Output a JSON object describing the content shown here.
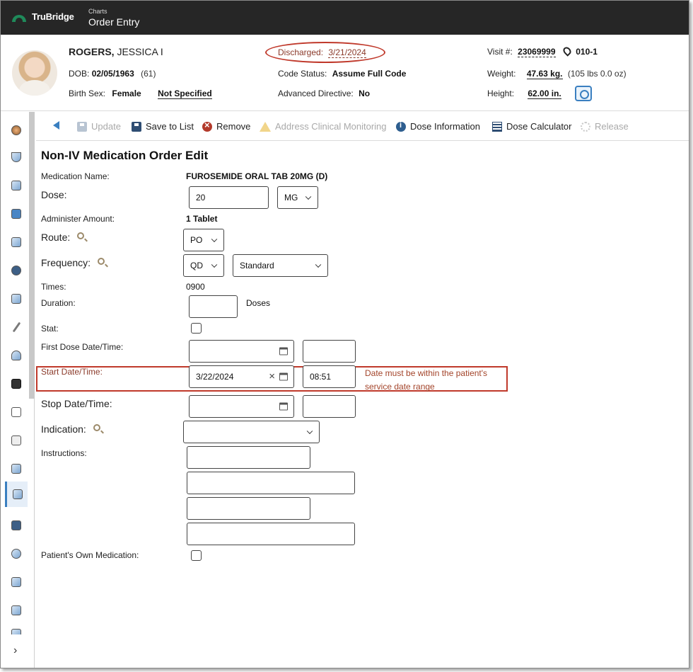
{
  "app": {
    "brand": "TruBridge",
    "breadcrumb_section": "Charts",
    "breadcrumb_page": "Order Entry"
  },
  "patient": {
    "last_name": "ROGERS,",
    "first_name": " JESSICA I",
    "dob_label": "DOB:",
    "dob": "02/05/1963",
    "age": "(61)",
    "birth_sex_label": "Birth Sex:",
    "birth_sex": "Female",
    "gender_identity": "Not Specified",
    "discharged_label": "Discharged:",
    "discharged_date": "3/21/2024",
    "code_status_label": "Code Status:",
    "code_status": "Assume Full Code",
    "advanced_directive_label": "Advanced Directive:",
    "advanced_directive": "No",
    "visit_label": "Visit #:",
    "visit_number": "23069999",
    "location": "010-1",
    "weight_label": "Weight:",
    "weight": "47.63 kg.",
    "weight_lbs": "(105 lbs 0.0 oz)",
    "height_label": "Height:",
    "height": "62.00 in."
  },
  "toolbar": {
    "update": "Update",
    "save_to_list": "Save to List",
    "remove": "Remove",
    "address_monitoring": "Address Clinical Monitoring",
    "dose_information": "Dose Information",
    "dose_calculator": "Dose Calculator",
    "release": "Release"
  },
  "form": {
    "title": "Non-IV Medication Order Edit",
    "medication_name_label": "Medication Name:",
    "medication_name": "FUROSEMIDE ORAL TAB 20MG (D)",
    "dose_label": "Dose:",
    "dose_value": "20",
    "dose_unit": "MG",
    "administer_amount_label": "Administer Amount:",
    "administer_amount": "1 Tablet",
    "route_label": "Route:",
    "route_value": "PO",
    "frequency_label": "Frequency:",
    "frequency_value": "QD",
    "frequency_type": "Standard",
    "times_label": "Times:",
    "times_value": "0900",
    "duration_label": "Duration:",
    "duration_value": "",
    "duration_unit": "Doses",
    "stat_label": "Stat:",
    "first_dose_label": "First Dose Date/Time:",
    "first_dose_date": "",
    "first_dose_time": "",
    "start_label": "Start Date/Time:",
    "start_date": "3/22/2024",
    "start_time": "08:51",
    "start_error": "Date must be within the patient's service date range",
    "stop_label": "Stop Date/Time:",
    "stop_date": "",
    "stop_time": "",
    "indication_label": "Indication:",
    "indication_value": "",
    "instructions_label": "Instructions:",
    "instructions": [
      "",
      "",
      "",
      ""
    ],
    "own_med_label": "Patient's Own Medication:"
  },
  "colors": {
    "topbar": "#262626",
    "brand_green": "#1f8a5a",
    "error_red": "#c0392b",
    "accent_blue": "#3a7fc0"
  },
  "icons": {
    "rail": [
      "clock-icon",
      "flask-icon",
      "checklist-icon",
      "chart-icon",
      "user-med-icon",
      "globe-icon",
      "rx-icon",
      "pen-icon",
      "nurse-icon",
      "monitor-icon",
      "doc-icon",
      "report-icon",
      "list-icon",
      "order-icon",
      "help-icon",
      "settings-icon",
      "staff-icon",
      "staff2-icon"
    ]
  }
}
